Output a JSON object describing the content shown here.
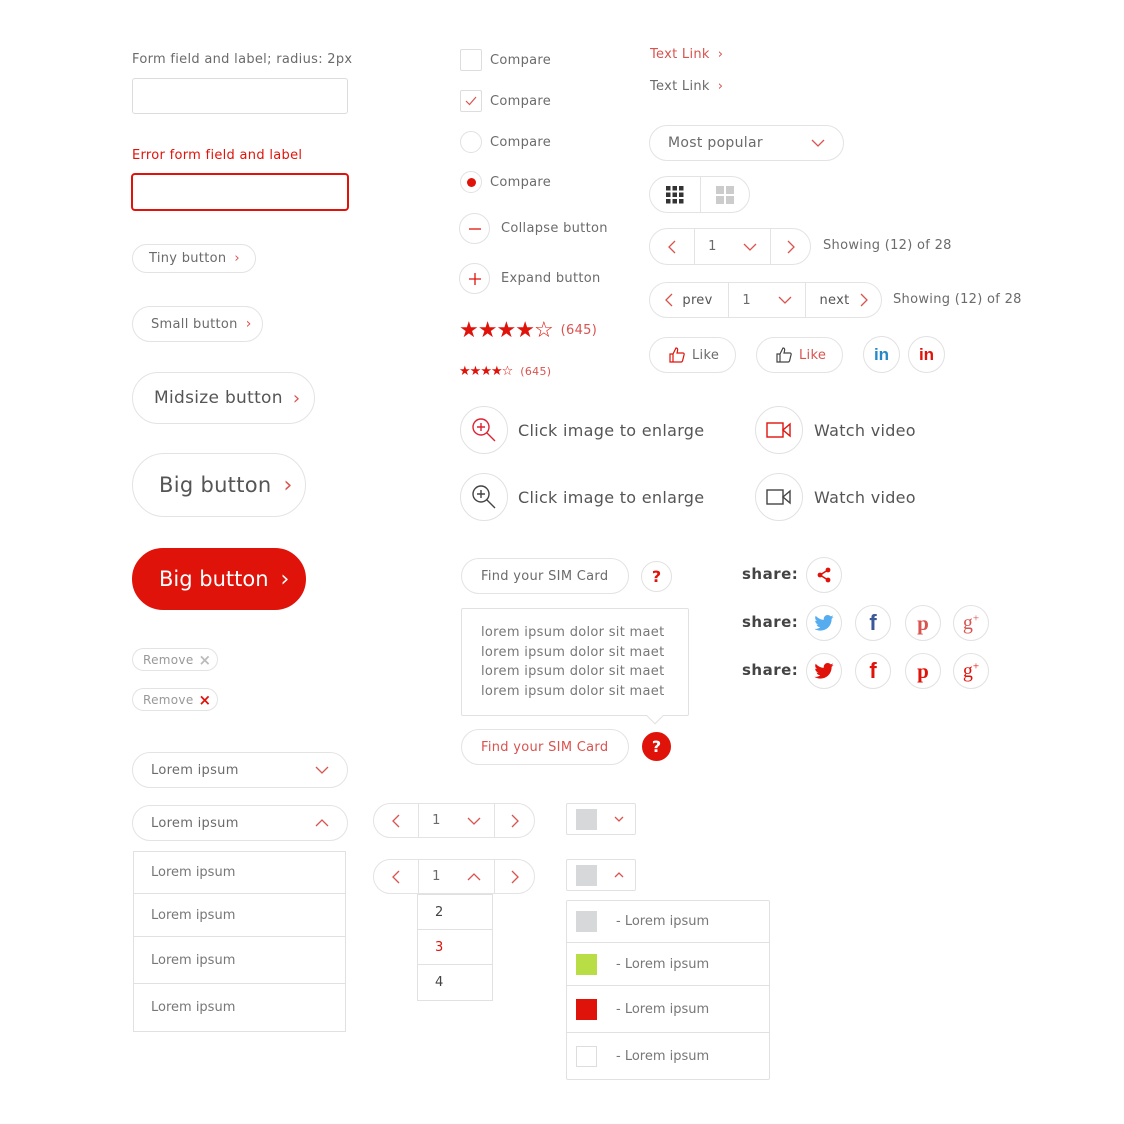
{
  "colors": {
    "accent": "#e0130a",
    "accent_light": "#d9534f",
    "text": "#6b6b6b",
    "border": "#e1e1e1",
    "twitter": "#55acee",
    "facebook": "#3b5998",
    "linkedin": "#0e76a8",
    "swatch_grey": "#d6d8d9",
    "swatch_green": "#b8dd45",
    "swatch_red": "#e0130a",
    "swatch_white": "#ffffff"
  },
  "forms": {
    "field_label": "Form field and label; radius: 2px",
    "field_value": "",
    "error_label": "Error form field and label",
    "error_value": ""
  },
  "buttons": {
    "tiny": "Tiny button",
    "small": "Small button",
    "midsize": "Midsize button",
    "big": "Big button",
    "big_primary": "Big button",
    "chevron": "›"
  },
  "tags": [
    {
      "label": "Remove",
      "icon": "×"
    },
    {
      "label": "Remove",
      "icon": "×"
    }
  ],
  "selects": {
    "closed": "Lorem ipsum",
    "open": "Lorem ipsum",
    "options": [
      "Lorem ipsum",
      "Lorem ipsum",
      "Lorem ipsum",
      "Lorem ipsum"
    ]
  },
  "compare": [
    {
      "label": "Compare",
      "type": "checkbox",
      "checked": false
    },
    {
      "label": "Compare",
      "type": "checkbox",
      "checked": true
    },
    {
      "label": "Compare",
      "type": "radio",
      "checked": false
    },
    {
      "label": "Compare",
      "type": "radio",
      "checked": true
    }
  ],
  "collapse_label": "Collapse button",
  "expand_label": "Expand button",
  "ratings": [
    {
      "stars": 4,
      "max": 5,
      "count": "(645)"
    },
    {
      "stars": 4,
      "max": 5,
      "count": "(645)"
    }
  ],
  "links": [
    "Text Link",
    "Text Link"
  ],
  "sort": {
    "selected": "Most popular"
  },
  "pagination": {
    "page": "1",
    "showing": "Showing (12) of 28",
    "prev": "prev",
    "next": "next",
    "mini_page": "1",
    "mini_options": [
      "2",
      "3",
      "4"
    ]
  },
  "like": [
    "Like",
    "Like"
  ],
  "media": {
    "enlarge": "Click image to enlarge",
    "video": "Watch video"
  },
  "sim": {
    "label": "Find your SIM Card",
    "help": "?",
    "tooltip": [
      "lorem ipsum dolor sit maet",
      "lorem ipsum dolor sit maet",
      "lorem ipsum dolor sit maet",
      "lorem ipsum dolor sit maet"
    ]
  },
  "share": {
    "label": "share:"
  },
  "color_select": {
    "options": [
      "- Lorem ipsum",
      "- Lorem ipsum",
      "- Lorem ipsum",
      "- Lorem ipsum"
    ]
  }
}
